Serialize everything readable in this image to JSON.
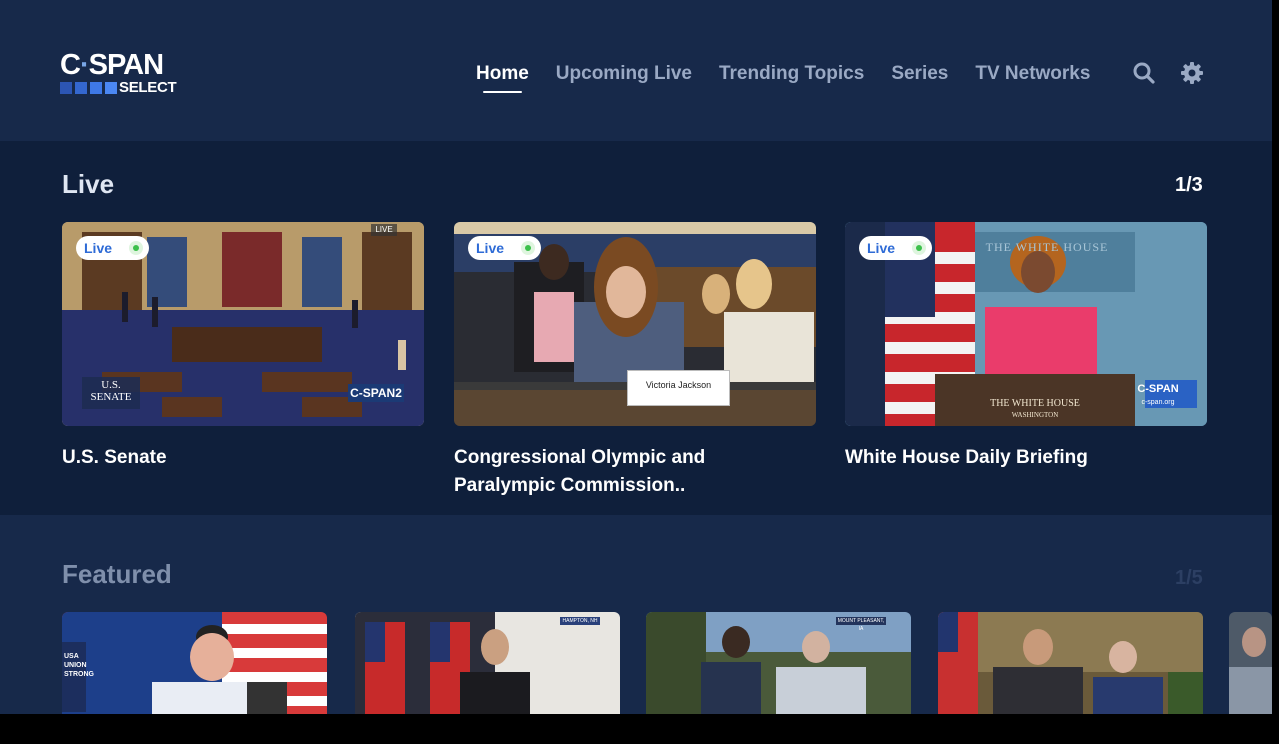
{
  "brand": {
    "top": "C-SPAN",
    "top_left": "C",
    "top_dot": "·",
    "top_right": "SPAN",
    "bottom": "SELECT"
  },
  "nav": {
    "items": [
      {
        "label": "Home",
        "active": true
      },
      {
        "label": "Upcoming Live",
        "active": false
      },
      {
        "label": "Trending Topics",
        "active": false
      },
      {
        "label": "Series",
        "active": false
      },
      {
        "label": "TV Networks",
        "active": false
      }
    ],
    "search_icon": "search-icon",
    "settings_icon": "gear-icon"
  },
  "live": {
    "title": "Live",
    "count": "1/3",
    "badge": "Live",
    "cards": [
      {
        "title": "U.S. Senate",
        "overlay_corner": "LIVE",
        "overlay_left": "U.S.\nSENATE",
        "overlay_left_1": "U.S.",
        "overlay_left_2": "SENATE",
        "network": "C-SPAN2"
      },
      {
        "title": "Congressional Olympic and Paralympic Commission..",
        "title_line1": "Congressional Olympic and",
        "title_line2": "Paralympic Commission..",
        "nameplate": "Victoria Jackson"
      },
      {
        "title": "White House Daily Briefing",
        "podium_1": "THE WHITE HOUSE",
        "podium_2": "WASHINGTON",
        "network": "C-SPAN",
        "network_sub": "c-span.org",
        "seal_text": "THE WHITE HOUSE"
      }
    ]
  },
  "featured": {
    "title": "Featured",
    "count": "1/5",
    "thumbs": [
      {
        "caption": "USA UNION STRONG"
      },
      {
        "caption": "HAMPTON, NH"
      },
      {
        "caption": "MOUNT PLEASANT, IA"
      },
      {
        "caption": ""
      }
    ]
  },
  "colors": {
    "header_bg": "#17294a",
    "live_bg": "#0f1f3b",
    "accent_blue": "#2e6bd6",
    "live_green": "#3cc04b",
    "nav_inactive": "#9aa9c4"
  }
}
